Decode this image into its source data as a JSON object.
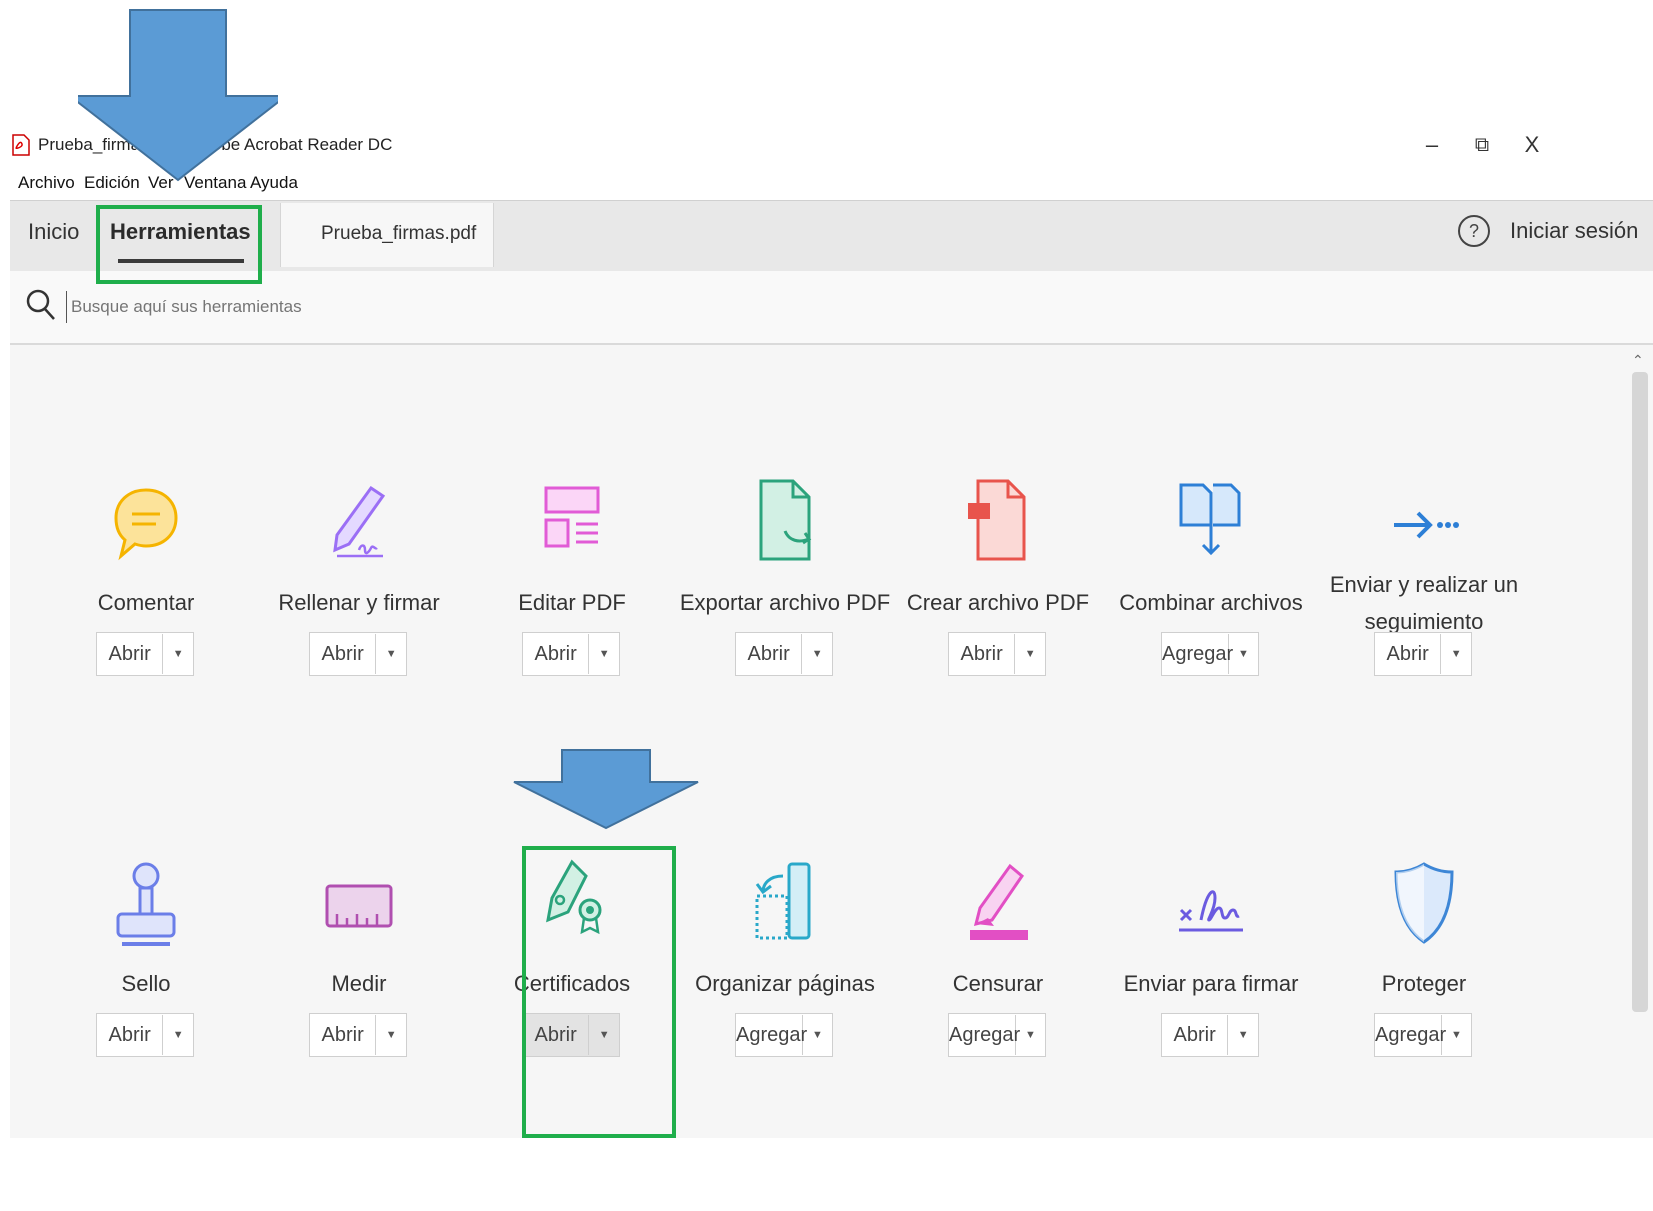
{
  "window": {
    "title": "Prueba_firmas.pdf - Adobe Acrobat Reader DC",
    "minimize": "–",
    "restore": "⧉",
    "close": "X"
  },
  "menubar": [
    "Archivo",
    "Edición",
    "Ver",
    "Ventana",
    "Ayuda"
  ],
  "tabs": {
    "home": "Inicio",
    "tools": "Herramientas",
    "document": "Prueba_firmas.pdf",
    "help_glyph": "?",
    "signin": "Iniciar sesión"
  },
  "search": {
    "placeholder": "Busque aquí sus herramientas",
    "icon": "search-icon"
  },
  "tools": [
    {
      "label": "Comentar",
      "button": "Abrir",
      "icon": "comment-icon",
      "color": "#f5b400"
    },
    {
      "label": "Rellenar y firmar",
      "button": "Abrir",
      "icon": "fill-sign-icon",
      "color": "#9b6ff5"
    },
    {
      "label": "Editar PDF",
      "button": "Abrir",
      "icon": "edit-pdf-icon",
      "color": "#e15bd6"
    },
    {
      "label": "Exportar archivo PDF",
      "button": "Abrir",
      "icon": "export-pdf-icon",
      "color": "#2ba37c"
    },
    {
      "label": "Crear archivo PDF",
      "button": "Abrir",
      "icon": "create-pdf-icon",
      "color": "#e8544c"
    },
    {
      "label": "Combinar archivos",
      "button": "Agregar",
      "icon": "combine-files-icon",
      "color": "#2d7fd6"
    },
    {
      "label": "Enviar y realizar un seguimiento",
      "button": "Abrir",
      "icon": "send-track-icon",
      "color": "#2d7fd6"
    },
    {
      "label": "Sello",
      "button": "Abrir",
      "icon": "stamp-icon",
      "color": "#6b7ee8"
    },
    {
      "label": "Medir",
      "button": "Abrir",
      "icon": "measure-icon",
      "color": "#b04fb0"
    },
    {
      "label": "Certificados",
      "button": "Abrir",
      "icon": "certificates-icon",
      "color": "#2ba37c"
    },
    {
      "label": "Organizar páginas",
      "button": "Agregar",
      "icon": "organize-pages-icon",
      "color": "#29a8c9"
    },
    {
      "label": "Censurar",
      "button": "Agregar",
      "icon": "redact-icon",
      "color": "#e24fc4"
    },
    {
      "label": "Enviar para firmar",
      "button": "Abrir",
      "icon": "send-sign-icon",
      "color": "#6b5be0"
    },
    {
      "label": "Proteger",
      "button": "Agregar",
      "icon": "protect-icon",
      "color": "#3d86d6"
    }
  ],
  "annotation_colors": {
    "arrow": "#5b9bd5",
    "highlight": "#1fae4b"
  }
}
